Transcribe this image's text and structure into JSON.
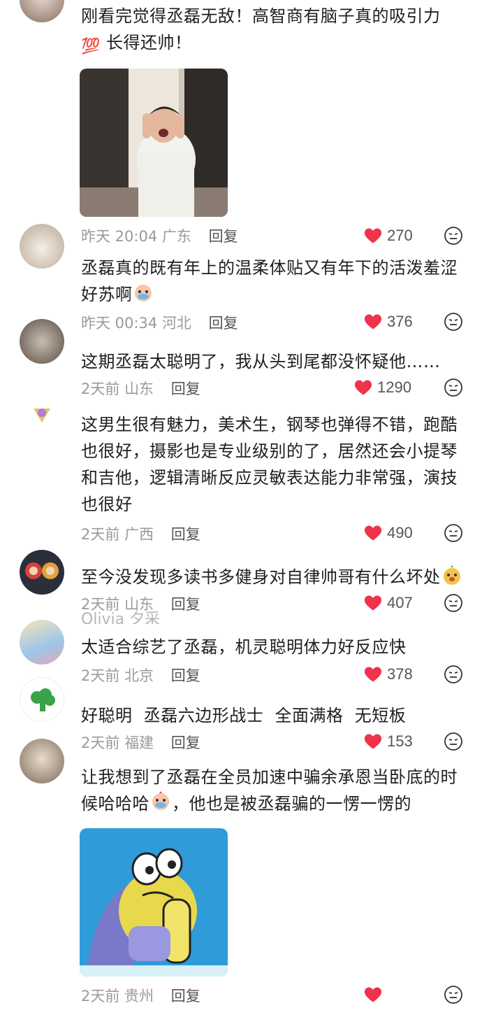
{
  "comments": [
    {
      "id": "c1",
      "text_lines": [
        "刚看完觉得丞磊无敌！高智商有脑子真的吸引力",
        "长得还帅！"
      ],
      "emoji": "💯",
      "date": "昨天 20:04",
      "location": "广东",
      "reply": "回复",
      "likes": "270"
    },
    {
      "id": "c2",
      "text_lines": [
        "丞磊真的既有年上的温柔体贴又有年下的活泼羞涩",
        "好苏啊"
      ],
      "date": "昨天 00:34",
      "location": "河北",
      "reply": "回复",
      "likes": "376"
    },
    {
      "id": "c3",
      "text_lines": [
        "这期丞磊太聪明了，我从头到尾都没怀疑他……"
      ],
      "date": "2天前",
      "location": "山东",
      "reply": "回复",
      "likes": "1290"
    },
    {
      "id": "c4",
      "text_lines": [
        "这男生很有魅力，美术生，钢琴也弹得不错，跑酷",
        "也很好，摄影也是专业级别的了，居然还会小提琴",
        "和吉他，逻辑清晰反应灵敏表达能力非常强，演技",
        "也很好"
      ],
      "date": "2天前",
      "location": "广西",
      "reply": "回复",
      "likes": "490"
    },
    {
      "id": "c5",
      "text_lines": [
        "至今没发现多读书多健身对自律帅哥有什么坏处"
      ],
      "date": "2天前",
      "location": "山东",
      "reply": "回复",
      "likes": "407"
    },
    {
      "id": "c6",
      "name_cut": "Olivia 夕采",
      "text_lines": [
        "太适合综艺了丞磊，机灵聪明体力好反应快"
      ],
      "date": "2天前",
      "location": "北京",
      "reply": "回复",
      "likes": "378"
    },
    {
      "id": "c7",
      "text_lines": [
        "好聪明  丞磊六边形战士  全面满格  无短板"
      ],
      "date": "2天前",
      "location": "福建",
      "reply": "回复",
      "likes": "153"
    },
    {
      "id": "c8",
      "text_lines": [
        "让我想到了丞磊在全员加速中骗余承恩当卧底的时",
        "候哈哈哈",
        "，他也是被丞磊骗的一愣一愣的"
      ],
      "date": "2天前",
      "location": "贵州",
      "reply": "回复",
      "likes": ""
    }
  ],
  "colors": {
    "like_red": "#f0324b",
    "meta_gray": "#9a9a9a",
    "text": "#1f1f1f"
  },
  "icons": {
    "like": "heart-icon",
    "dislike": "dislike-face-icon"
  }
}
